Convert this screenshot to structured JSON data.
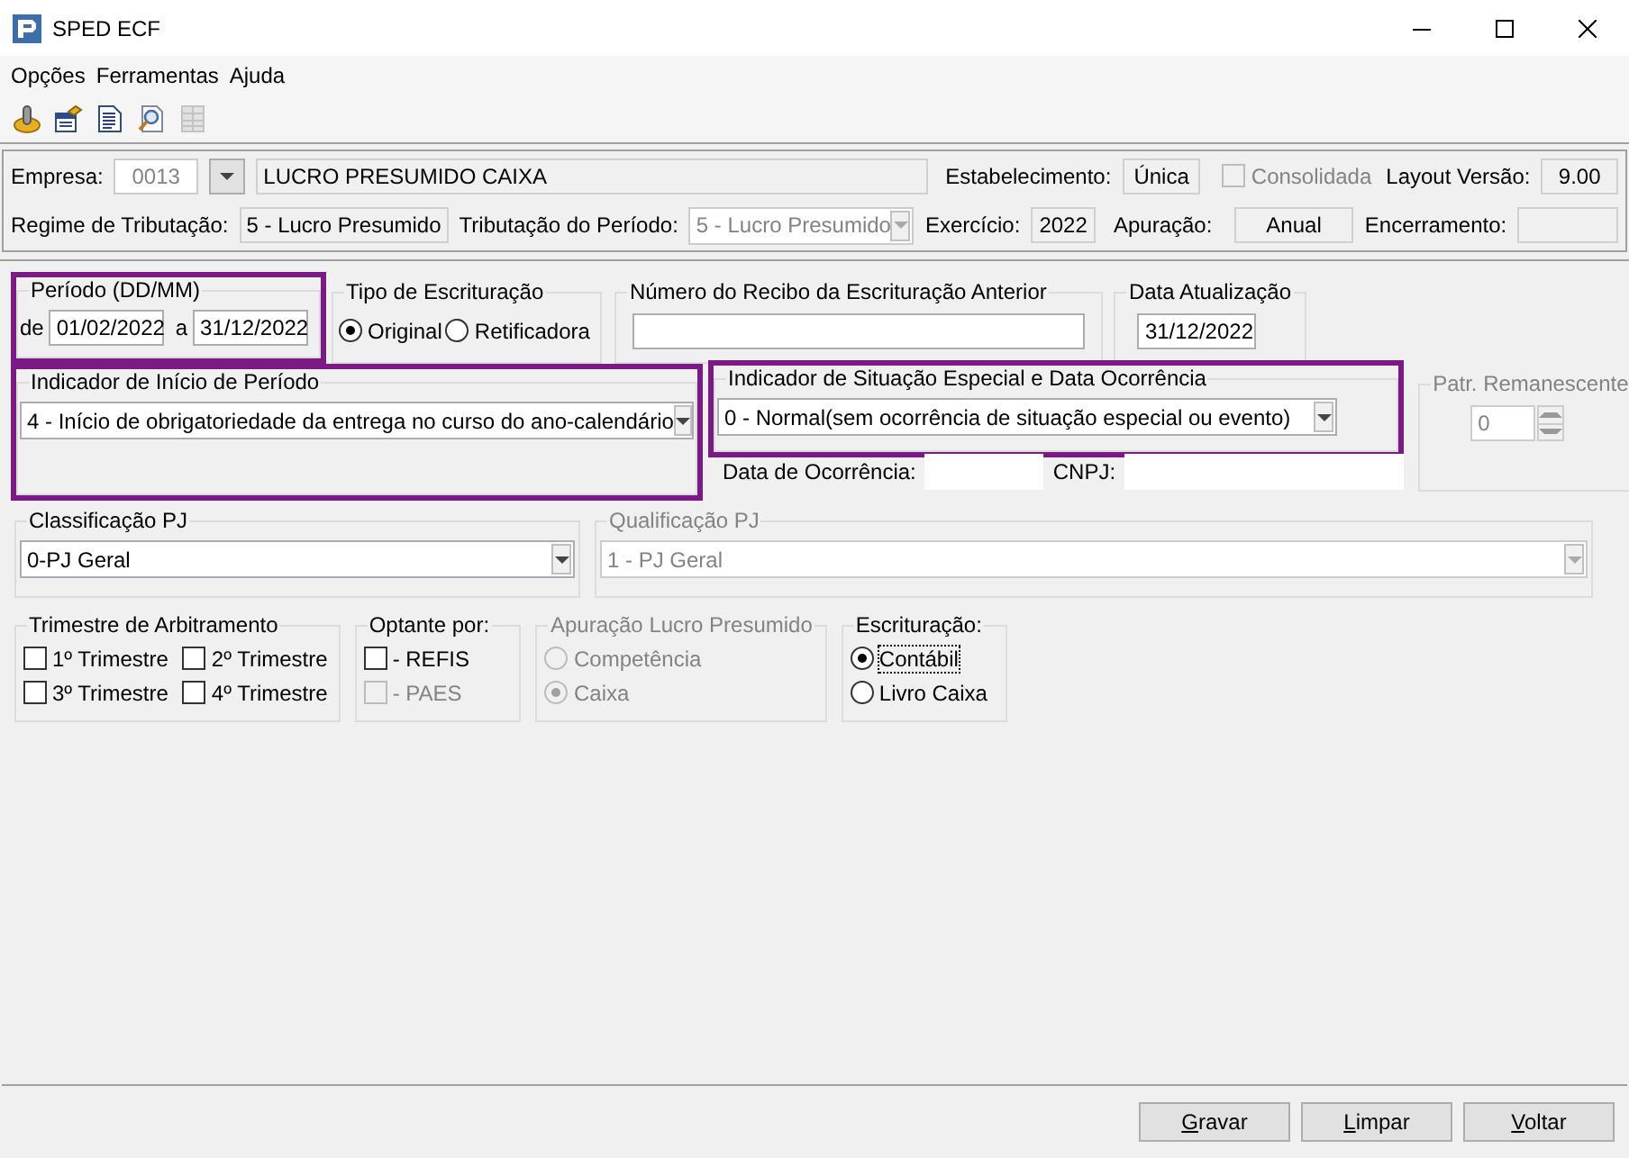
{
  "window": {
    "title": "SPED ECF"
  },
  "menu": [
    {
      "label": "Opções"
    },
    {
      "label": "Ferramentas"
    },
    {
      "label": "Ajuda"
    }
  ],
  "toolbar": [
    {
      "kind": "knob",
      "disabled": false
    },
    {
      "kind": "card",
      "disabled": false
    },
    {
      "kind": "document",
      "disabled": false
    },
    {
      "kind": "preview",
      "disabled": false
    },
    {
      "kind": "grid",
      "disabled": true
    }
  ],
  "header": {
    "empresa": {
      "label": "Empresa:",
      "code": "0013",
      "name": "LUCRO PRESUMIDO CAIXA"
    },
    "estabelecimento": {
      "label": "Estabelecimento:",
      "value": "Única"
    },
    "consolidada": {
      "label": "Consolidada",
      "checked": false,
      "disabled": true
    },
    "layout_versao": {
      "label": "Layout Versão:",
      "value": "9.00"
    },
    "regime": {
      "label": "Regime de Tributação:",
      "value": "5 - Lucro Presumido"
    },
    "tributacao_periodo": {
      "label": "Tributação do Período:",
      "value": "5 - Lucro Presumido",
      "disabled": true
    },
    "exercicio": {
      "label": "Exercício:",
      "value": "2022"
    },
    "apuracao": {
      "label": "Apuração:",
      "value": "Anual"
    },
    "encerramento": {
      "label": "Encerramento:"
    }
  },
  "periodo": {
    "title": "Período (DD/MM)",
    "highlighted": true,
    "from_label": "de",
    "from": "01/02/2022",
    "to_label": "a",
    "to": "31/12/2022"
  },
  "tipo_escrituracao": {
    "title": "Tipo de Escrituração",
    "options": [
      {
        "label": "Original",
        "selected": true
      },
      {
        "label": "Retificadora",
        "selected": false
      }
    ]
  },
  "recibo_anterior": {
    "title": "Número do Recibo da Escrituração Anterior"
  },
  "data_atualizacao": {
    "title": "Data Atualização",
    "value": "31/12/2022"
  },
  "indicador_inicio": {
    "title": "Indicador de Início de Período",
    "highlighted": true,
    "value": "4 - Início de obrigatoriedade da entrega no curso do ano-calendário"
  },
  "indicador_situacao": {
    "title": "Indicador de Situação Especial e Data Ocorrência",
    "highlighted": true,
    "value": "0 - Normal(sem ocorrência de situação especial ou evento)",
    "data_label": "Data de Ocorrência:",
    "cnpj_label": "CNPJ:"
  },
  "patr_remanescente": {
    "title": "Patr. Remanescente",
    "value": "0",
    "disabled": true
  },
  "classificacao_pj": {
    "title": "Classificação PJ",
    "value": "0-PJ Geral",
    "disabled": false
  },
  "qualificacao_pj": {
    "title": "Qualificação PJ",
    "value": "1 - PJ Geral",
    "disabled": true
  },
  "trimestre_arbitramento": {
    "title": "Trimestre de Arbitramento",
    "items": [
      {
        "label": "1º Trimestre",
        "checked": false
      },
      {
        "label": "2º Trimestre",
        "checked": false
      },
      {
        "label": "3º Trimestre",
        "checked": false
      },
      {
        "label": "4º Trimestre",
        "checked": false
      }
    ]
  },
  "optante": {
    "title": "Optante por:",
    "items": [
      {
        "label": "- REFIS",
        "checked": false,
        "disabled": false
      },
      {
        "label": "- PAES",
        "checked": false,
        "disabled": true
      }
    ]
  },
  "apuracao_lucro_presumido": {
    "title": "Apuração Lucro Presumido",
    "disabled": true,
    "options": [
      {
        "label": "Competência",
        "selected": false
      },
      {
        "label": "Caixa",
        "selected": true
      }
    ]
  },
  "escrituracao": {
    "title": "Escrituração:",
    "options": [
      {
        "label": "Contábil",
        "selected": true,
        "focused": true
      },
      {
        "label": "Livro Caixa",
        "selected": false,
        "focused": false
      }
    ]
  },
  "buttons": [
    {
      "label": "Gravar"
    },
    {
      "label": "Limpar"
    },
    {
      "label": "Voltar"
    }
  ]
}
